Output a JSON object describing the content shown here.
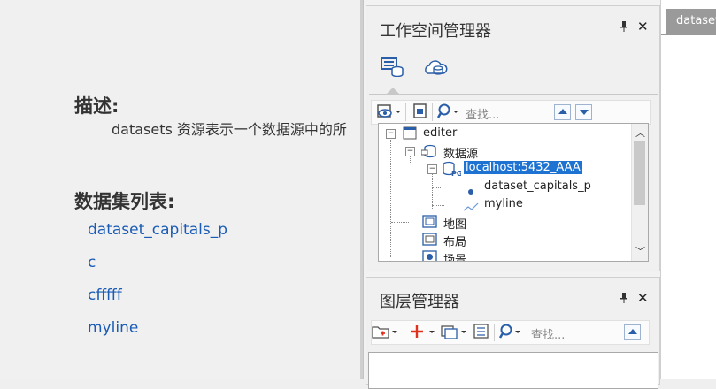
{
  "document": {
    "desc_heading": "描述:",
    "desc_text": "datasets 资源表示一个数据源中的所",
    "list_heading": "数据集列表:",
    "links": [
      "dataset_capitals_p",
      "c",
      "cfffff",
      "myline"
    ]
  },
  "workspace": {
    "title": "工作空间管理器",
    "pin_glyph": "📌",
    "close_glyph": "✕",
    "tab_icons": [
      "workspace-datasource-icon",
      "cloud-datasource-icon"
    ],
    "toolbar": {
      "search_placeholder": "查找..."
    },
    "tree": {
      "root": "editer",
      "datasources": "数据源",
      "connection": "localhost:5432_AAA",
      "datasets": [
        "dataset_capitals_p",
        "myline"
      ],
      "maps": "地图",
      "layouts": "布局",
      "scenes": "场景"
    }
  },
  "layer_manager": {
    "title": "图层管理器",
    "toolbar": {
      "search_placeholder": "查找..."
    }
  },
  "doc_tab": {
    "label": "dataset"
  },
  "colors": {
    "link": "#1a5bb5",
    "selection": "#1e73d2",
    "accent_red": "#e0301e",
    "icon_blue": "#2a5ea8"
  }
}
